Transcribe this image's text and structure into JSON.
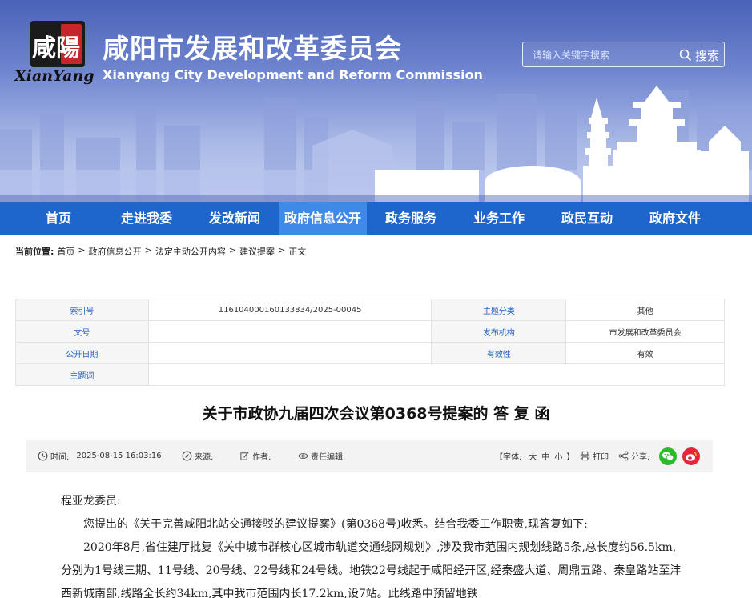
{
  "header": {
    "logo_cn": "咸陽",
    "logo_en": "XianYang",
    "title_cn": "咸阳市发展和改革委员会",
    "title_en": "Xianyang City Development and Reform Commission",
    "search_placeholder": "请输入关键字搜索",
    "search_label": "搜索"
  },
  "nav": {
    "items": [
      "首页",
      "走进我委",
      "发改新闻",
      "政府信息公开",
      "政务服务",
      "业务工作",
      "政民互动",
      "政府文件"
    ],
    "active_index": 3
  },
  "breadcrumb": {
    "label": "当前位置:",
    "items": [
      "首页",
      "政府信息公开",
      "法定主动公开内容",
      "建议提案",
      "正文"
    ],
    "sep": ">"
  },
  "meta": {
    "rows": [
      {
        "k1": "索引号",
        "v1": "116104000160133834/2025-00045",
        "k2": "主题分类",
        "v2": "其他"
      },
      {
        "k1": "文号",
        "v1": "",
        "k2": "发布机构",
        "v2": "市发展和改革委员会"
      },
      {
        "k1": "公开日期",
        "v1": "",
        "k2": "有效性",
        "v2": "有效"
      },
      {
        "k1": "主题词",
        "v1": ""
      }
    ]
  },
  "doc": {
    "title": "关于市政协九届四次会议第0368号提案的 答 复 函"
  },
  "info_bar": {
    "time_label": "时间:",
    "time_value": "2025-08-15 16:03:16",
    "source_label": "来源:",
    "author_label": "作者:",
    "editor_label": "责任编辑:",
    "font_label": "【字体:",
    "font_large": "大",
    "font_medium": "中",
    "font_small": "小",
    "font_close": "】",
    "print_label": "打印",
    "share_label": "分享:",
    "wechat_color": "#2dbb2d",
    "weibo_color": "#e0283a"
  },
  "body": {
    "salutation": "程亚龙委员:",
    "p1": "您提出的《关于完善咸阳北站交通接驳的建议提案》(第0368号)收悉。结合我委工作职责,现答复如下:",
    "p2": "2020年8月,省住建厅批复《关中城市群核心区城市轨道交通线网规划》,涉及我市范围内规划线路5条,总长度约56.5km,分别为1号线三期、11号线、20号线、22号线和24号线。地铁22号线起于咸阳经开区,经秦盛大道、周鼎五路、秦皇路站至沣西新城南部,线路全长约34km,其中我市范围内长17.2km,设7站。此线路中预留地铁"
  }
}
